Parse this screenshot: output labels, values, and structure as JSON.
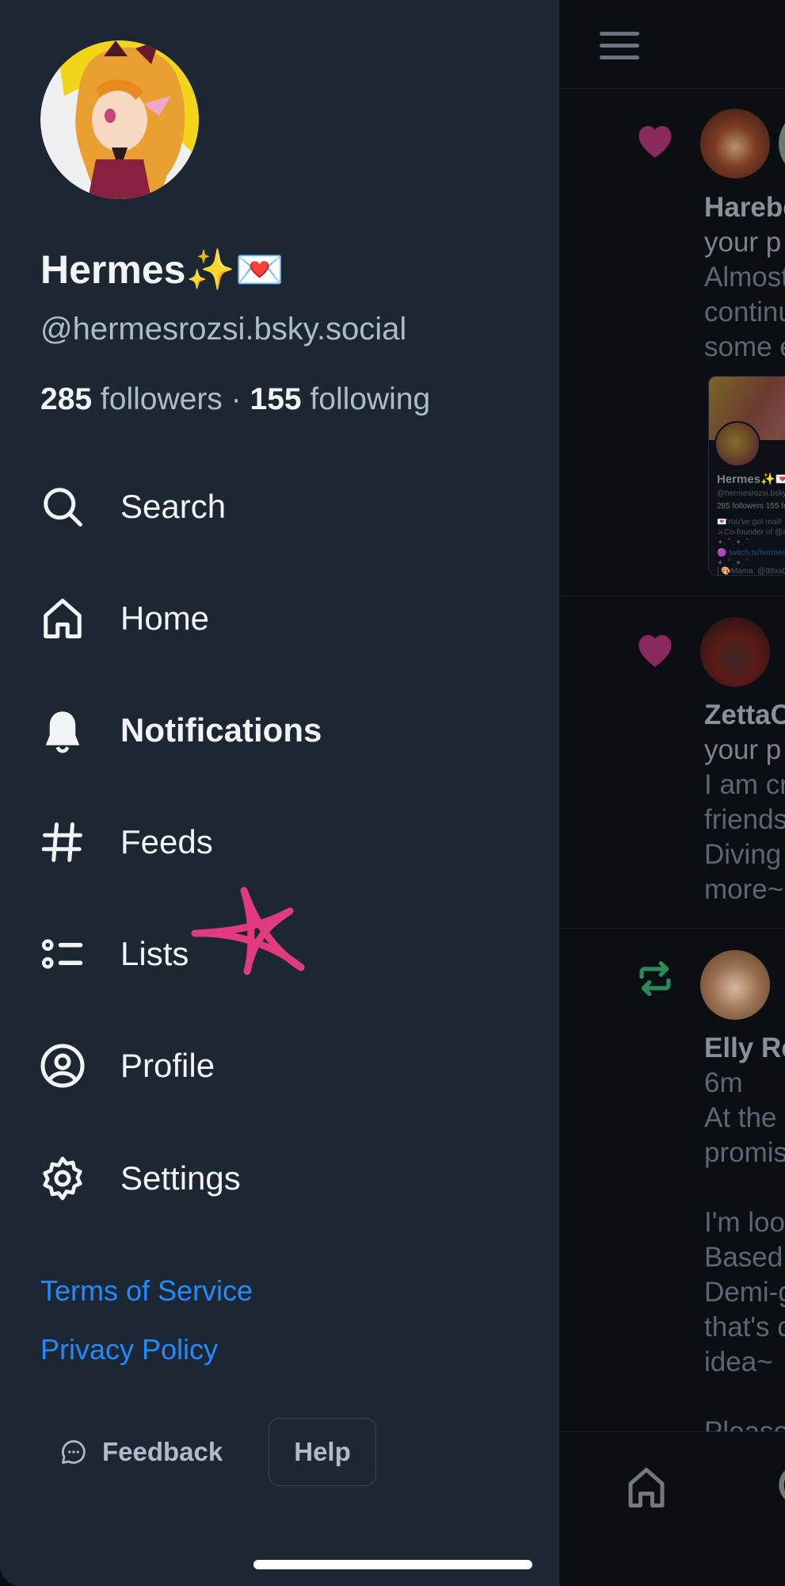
{
  "drawer": {
    "profile": {
      "display_name": "Hermes✨💌",
      "handle": "@hermesrozsi.bsky.social",
      "followers_count": "285",
      "followers_label": "followers",
      "separator": "·",
      "following_count": "155",
      "following_label": "following"
    },
    "menu": [
      {
        "id": "search",
        "label": "Search",
        "icon": "search-icon",
        "active": false
      },
      {
        "id": "home",
        "label": "Home",
        "icon": "home-icon",
        "active": false
      },
      {
        "id": "notifications",
        "label": "Notifications",
        "icon": "bell-icon",
        "active": true
      },
      {
        "id": "feeds",
        "label": "Feeds",
        "icon": "hashtag-icon",
        "active": false
      },
      {
        "id": "lists",
        "label": "Lists",
        "icon": "list-icon",
        "active": false
      },
      {
        "id": "profile",
        "label": "Profile",
        "icon": "user-circle-icon",
        "active": false
      },
      {
        "id": "settings",
        "label": "Settings",
        "icon": "gear-icon",
        "active": false
      }
    ],
    "links": {
      "terms": "Terms of Service",
      "privacy": "Privacy Policy"
    },
    "footer": {
      "feedback_label": "Feedback",
      "help_label": "Help"
    },
    "annotation": "hand-drawn-pink-star"
  },
  "feed": {
    "header_icon": "hamburger-menu-icon",
    "items": [
      {
        "type": "like",
        "icon": "heart-icon",
        "author": "Harebe",
        "action": "your p",
        "lines": [
          "Almost",
          "continu",
          "some e"
        ],
        "embed": {
          "name": "Hermes✨💌",
          "handle": "@hermesrozsi.bsky.",
          "stats": "285 followers  155 fo",
          "bio": [
            "💌You've got mail! H",
            "⚔Co-founder of @a",
            "✦.  ˚  .✦.  ˚",
            "🟣 twitch.tv/hermes",
            "✦.  ˚  .✦.  ˚",
            "| 🎨Mama: @99xs0c"
          ]
        }
      },
      {
        "type": "like",
        "icon": "heart-icon",
        "author": "ZettaC",
        "action": "your p",
        "lines": [
          "I am cr",
          "friends",
          "Diving",
          "more~"
        ]
      },
      {
        "type": "repost",
        "icon": "repost-icon",
        "author": "Elly Re",
        "time": "6m",
        "lines": [
          "At the",
          "promis",
          "",
          "I'm loo",
          "Based",
          "Demi-g",
          "that's c",
          "idea~",
          "",
          "Please"
        ]
      }
    ],
    "bottom_nav": [
      "home-icon",
      "search-icon"
    ]
  },
  "colors": {
    "drawer_bg": "#1d2734",
    "text_primary": "#f1f3f5",
    "text_secondary": "#aebbc9",
    "link": "#208bfe",
    "like": "#8a2a5c",
    "repost": "#2a8a5a",
    "annotation": "#e23a7e"
  }
}
